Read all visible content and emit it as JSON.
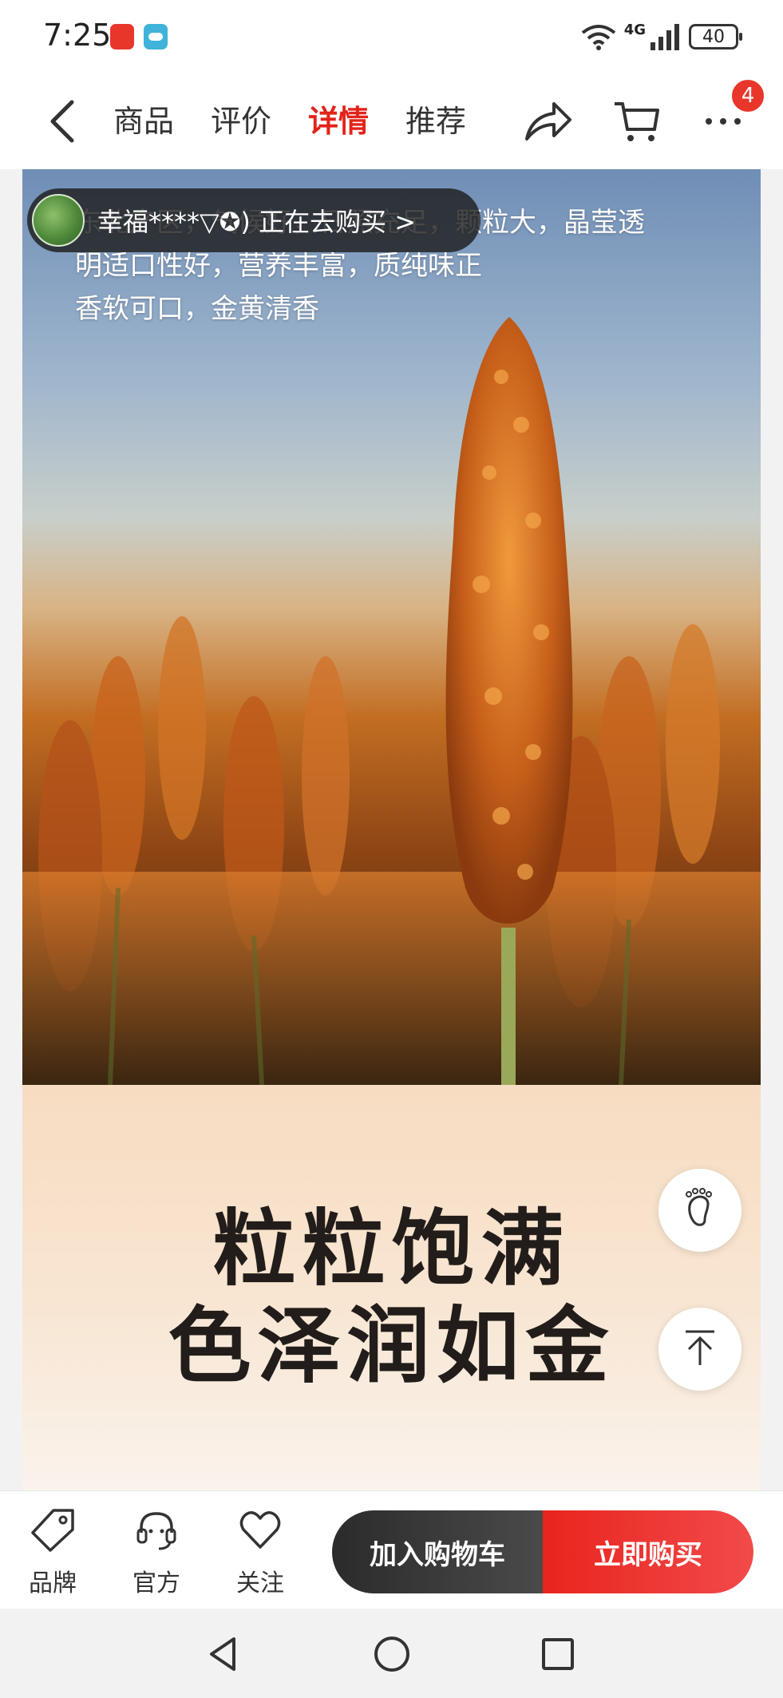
{
  "status_bar": {
    "time": "7:25",
    "network": "4G",
    "battery": "40"
  },
  "nav": {
    "tabs": [
      {
        "label": "商品",
        "active": false
      },
      {
        "label": "评价",
        "active": false
      },
      {
        "label": "详情",
        "active": true
      },
      {
        "label": "推荐",
        "active": false
      }
    ],
    "more_badge": "4",
    "accent_color": "#e2231a"
  },
  "ticker": {
    "text": "幸福****▽✪)  正在去购买 >"
  },
  "hero": {
    "partial_top_text": "东北产区 吸收阳光 充足",
    "description_lines": [
      "东北产区，气候好，日照充足，颗粒大，晶莹透",
      "明适口性好，营养丰富，质纯味正",
      "香软可口，金黄清香"
    ]
  },
  "banner": {
    "line1": "粒粒饱满",
    "line2": "色泽润如金"
  },
  "bottom_bar": {
    "brand_label": "品牌",
    "official_label": "官方",
    "follow_label": "关注",
    "add_to_cart": "加入购物车",
    "buy_now": "立即购买",
    "buy_color": "#e8251e"
  },
  "icons": {
    "back": "back-arrow-icon",
    "share": "share-icon",
    "cart": "cart-icon",
    "more": "more-icon",
    "footprint": "footprint-icon",
    "to_top": "back-to-top-icon",
    "brand": "tag-icon",
    "official": "headset-icon",
    "follow": "heart-icon"
  }
}
